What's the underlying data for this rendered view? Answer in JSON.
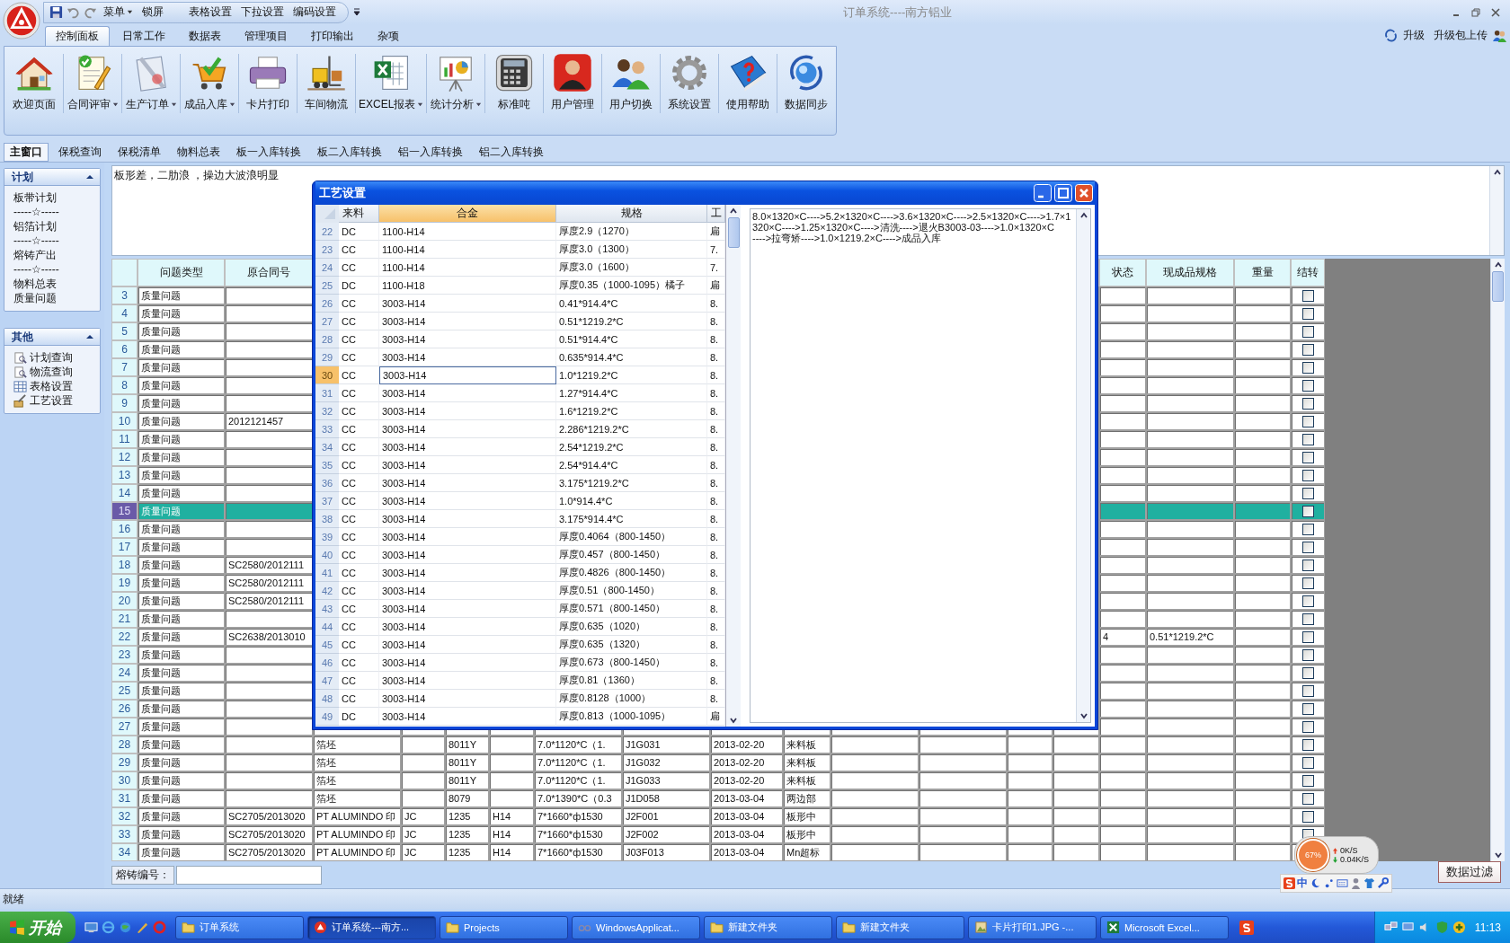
{
  "window": {
    "title": "订单系统----南方铝业"
  },
  "quick_access": {
    "menu": "菜单",
    "lock": "锁屏",
    "items": [
      "表格设置",
      "下拉设置",
      "编码设置"
    ]
  },
  "ribbon_tabs": [
    {
      "label": "控制面板",
      "selected": true
    },
    {
      "label": "日常工作",
      "selected": false
    },
    {
      "label": "数据表",
      "selected": false
    },
    {
      "label": "管理项目",
      "selected": false
    },
    {
      "label": "打印输出",
      "selected": false
    },
    {
      "label": "杂项",
      "selected": false
    }
  ],
  "ribbon_links": [
    "升级",
    "升级包上传"
  ],
  "ribbon_buttons": [
    {
      "label": "欢迎页面",
      "has_menu": false
    },
    {
      "label": "合同评审",
      "has_menu": true
    },
    {
      "label": "生产订单",
      "has_menu": true
    },
    {
      "label": "成品入库",
      "has_menu": true
    },
    {
      "label": "卡片打印",
      "has_menu": false
    },
    {
      "label": "车间物流",
      "has_menu": false
    },
    {
      "label": "EXCEL报表",
      "has_menu": true
    },
    {
      "label": "统计分析",
      "has_menu": true
    },
    {
      "label": "标准吨",
      "has_menu": false
    },
    {
      "label": "用户管理",
      "has_menu": false
    },
    {
      "label": "用户切换",
      "has_menu": false
    },
    {
      "label": "系统设置",
      "has_menu": false
    },
    {
      "label": "使用帮助",
      "has_menu": false
    },
    {
      "label": "数据同步",
      "has_menu": false
    }
  ],
  "doc_tabs": [
    {
      "label": "主窗口",
      "selected": true
    },
    {
      "label": "保税查询",
      "selected": false
    },
    {
      "label": "保税清单",
      "selected": false
    },
    {
      "label": "物料总表",
      "selected": false
    },
    {
      "label": "板一入库转换",
      "selected": false
    },
    {
      "label": "板二入库转换",
      "selected": false
    },
    {
      "label": "铝一入库转换",
      "selected": false
    },
    {
      "label": "铝二入库转换",
      "selected": false
    }
  ],
  "sidebar": {
    "panels": [
      {
        "title": "计划",
        "expanded": true,
        "items": [
          {
            "label": "板带计划",
            "kind": "link"
          },
          {
            "label": "-----☆-----",
            "kind": "separator"
          },
          {
            "label": "铝箔计划",
            "kind": "link"
          },
          {
            "label": "-----☆-----",
            "kind": "separator"
          },
          {
            "label": "熔铸产出",
            "kind": "link"
          },
          {
            "label": "-----☆-----",
            "kind": "separator"
          },
          {
            "label": "物料总表",
            "kind": "link"
          },
          {
            "label": "质量问题",
            "kind": "link"
          }
        ]
      },
      {
        "title": "其他",
        "expanded": true,
        "items": [
          {
            "label": "计划查询",
            "kind": "icon_link"
          },
          {
            "label": "物流查询",
            "kind": "icon_link"
          },
          {
            "label": "表格设置",
            "kind": "icon_link"
          },
          {
            "label": "工艺设置",
            "kind": "icon_link"
          }
        ]
      }
    ]
  },
  "memo": {
    "value": "板形差，二肋浪 ，操边大波浪明显"
  },
  "table": {
    "headers": {
      "problem_type": "问题类型",
      "original_contract_no": "原合同号",
      "status": "状态",
      "finished_spec": "现成品规格",
      "weight": "重量",
      "carry_over": "结转"
    },
    "rows": [
      {
        "number": "3",
        "selected": false,
        "problem_type": "质量问题",
        "carry_over": false
      },
      {
        "number": "4",
        "selected": false,
        "problem_type": "质量问题",
        "carry_over": false
      },
      {
        "number": "5",
        "selected": false,
        "problem_type": "质量问题",
        "carry_over": false
      },
      {
        "number": "6",
        "selected": false,
        "problem_type": "质量问题",
        "carry_over": false
      },
      {
        "number": "7",
        "selected": false,
        "problem_type": "质量问题",
        "carry_over": false
      },
      {
        "number": "8",
        "selected": false,
        "problem_type": "质量问题",
        "carry_over": false
      },
      {
        "number": "9",
        "selected": false,
        "problem_type": "质量问题",
        "carry_over": false
      },
      {
        "number": "10",
        "selected": false,
        "problem_type": "质量问题",
        "original_contract_no": "2012121457",
        "carry_over": false
      },
      {
        "number": "11",
        "selected": false,
        "problem_type": "质量问题",
        "carry_over": false
      },
      {
        "number": "12",
        "selected": false,
        "problem_type": "质量问题",
        "carry_over": false
      },
      {
        "number": "13",
        "selected": false,
        "problem_type": "质量问题",
        "carry_over": false
      },
      {
        "number": "14",
        "selected": false,
        "problem_type": "质量问题",
        "carry_over": false
      },
      {
        "number": "15",
        "selected": true,
        "problem_type": "质量问题",
        "carry_over": false
      },
      {
        "number": "16",
        "selected": false,
        "problem_type": "质量问题",
        "carry_over": false
      },
      {
        "number": "17",
        "selected": false,
        "problem_type": "质量问题",
        "carry_over": false
      },
      {
        "number": "18",
        "selected": false,
        "problem_type": "质量问题",
        "original_contract_no": "SC2580/2012111",
        "carry_over": false
      },
      {
        "number": "19",
        "selected": false,
        "problem_type": "质量问题",
        "original_contract_no": "SC2580/2012111",
        "carry_over": false
      },
      {
        "number": "20",
        "selected": false,
        "problem_type": "质量问题",
        "original_contract_no": "SC2580/2012111",
        "carry_over": false
      },
      {
        "number": "21",
        "selected": false,
        "problem_type": "质量问题",
        "carry_over": false
      },
      {
        "number": "22",
        "selected": false,
        "problem_type": "质量问题",
        "original_contract_no": "SC2638/2013010",
        "status": "4",
        "finished_spec": "0.51*1219.2*C",
        "carry_over": false
      },
      {
        "number": "23",
        "selected": false,
        "problem_type": "质量问题",
        "carry_over": false
      },
      {
        "number": "24",
        "selected": false,
        "problem_type": "质量问题",
        "carry_over": false
      },
      {
        "number": "25",
        "selected": false,
        "problem_type": "质量问题",
        "carry_over": false
      },
      {
        "number": "26",
        "selected": false,
        "problem_type": "质量问题",
        "carry_over": false
      },
      {
        "number": "27",
        "selected": false,
        "problem_type": "质量问题",
        "carry_over": false
      },
      {
        "number": "28",
        "selected": false,
        "problem_type": "质量问题",
        "column_3": "箔坯",
        "column_5": "8011Y",
        "column_7": "7.0*1120*C（1.",
        "column_8": "J1G031",
        "column_9": "2013-02-20",
        "column_10": "来料板",
        "carry_over": false
      },
      {
        "number": "29",
        "selected": false,
        "problem_type": "质量问题",
        "column_3": "箔坯",
        "column_5": "8011Y",
        "column_7": "7.0*1120*C（1.",
        "column_8": "J1G032",
        "column_9": "2013-02-20",
        "column_10": "来料板",
        "carry_over": false
      },
      {
        "number": "30",
        "selected": false,
        "problem_type": "质量问题",
        "column_3": "箔坯",
        "column_5": "8011Y",
        "column_7": "7.0*1120*C（1.",
        "column_8": "J1G033",
        "column_9": "2013-02-20",
        "column_10": "来料板",
        "carry_over": false
      },
      {
        "number": "31",
        "selected": false,
        "problem_type": "质量问题",
        "column_3": "箔坯",
        "column_5": "8079",
        "column_7": "7.0*1390*C（0.3",
        "column_8": "J1D058",
        "column_9": "2013-03-04",
        "column_10": "两边部",
        "carry_over": false
      },
      {
        "number": "32",
        "selected": false,
        "problem_type": "质量问题",
        "original_contract_no": "SC2705/2013020",
        "column_3": "PT ALUMINDO 印",
        "column_4": "JC",
        "column_5": "1235",
        "column_6": "H14",
        "column_7": "7*1660*ф1530",
        "column_8": "J2F001",
        "column_9": "2013-03-04",
        "column_10": "板形中",
        "carry_over": false
      },
      {
        "number": "33",
        "selected": false,
        "problem_type": "质量问题",
        "original_contract_no": "SC2705/2013020",
        "column_3": "PT ALUMINDO 印",
        "column_4": "JC",
        "column_5": "1235",
        "column_6": "H14",
        "column_7": "7*1660*ф1530",
        "column_8": "J2F002",
        "column_9": "2013-03-04",
        "column_10": "板形中",
        "carry_over": false
      },
      {
        "number": "34",
        "selected": false,
        "problem_type": "质量问题",
        "original_contract_no": "SC2705/2013020",
        "column_3": "PT ALUMINDO 印",
        "column_4": "JC",
        "column_5": "1235",
        "column_6": "H14",
        "column_7": "7*1660*ф1530",
        "column_8": "J03F013",
        "column_9": "2013-03-04",
        "column_10": "Mn超标"
      }
    ]
  },
  "casting_no": {
    "label": "熔铸编号："
  },
  "network_meter": {
    "load": "67%",
    "upload": "0K/S",
    "download": "0.04K/S"
  },
  "ime_bar": {
    "mode": "中"
  },
  "filter_button": "数据过滤",
  "status_bar": "就绪",
  "dialog": {
    "title": "工艺设置",
    "columns": [
      {
        "label": "来料",
        "selected": false
      },
      {
        "label": "合金",
        "selected": true
      },
      {
        "label": "规格",
        "selected": false
      },
      {
        "label": "工",
        "selected": false
      }
    ],
    "rows": [
      {
        "number": "22",
        "selected": false,
        "source": "DC",
        "alloy": "1100-H14",
        "spec": "厚度2.9（1270）",
        "process": "扁"
      },
      {
        "number": "23",
        "selected": false,
        "source": "CC",
        "alloy": "1100-H14",
        "spec": "厚度3.0（1300）",
        "process": "7."
      },
      {
        "number": "24",
        "selected": false,
        "source": "CC",
        "alloy": "1100-H14",
        "spec": "厚度3.0（1600）",
        "process": "7."
      },
      {
        "number": "25",
        "selected": false,
        "source": "DC",
        "alloy": "1100-H18",
        "spec": "厚度0.35（1000-1095）橘子",
        "process": "扁"
      },
      {
        "number": "26",
        "selected": false,
        "source": "CC",
        "alloy": "3003-H14",
        "spec": "0.41*914.4*C",
        "process": "8."
      },
      {
        "number": "27",
        "selected": false,
        "source": "CC",
        "alloy": "3003-H14",
        "spec": "0.51*1219.2*C",
        "process": "8."
      },
      {
        "number": "28",
        "selected": false,
        "source": "CC",
        "alloy": "3003-H14",
        "spec": "0.51*914.4*C",
        "process": "8."
      },
      {
        "number": "29",
        "selected": false,
        "source": "CC",
        "alloy": "3003-H14",
        "spec": "0.635*914.4*C",
        "process": "8."
      },
      {
        "number": "30",
        "selected": true,
        "source": "CC",
        "alloy": "3003-H14",
        "spec": "1.0*1219.2*C",
        "process": "8."
      },
      {
        "number": "31",
        "selected": false,
        "source": "CC",
        "alloy": "3003-H14",
        "spec": "1.27*914.4*C",
        "process": "8."
      },
      {
        "number": "32",
        "selected": false,
        "source": "CC",
        "alloy": "3003-H14",
        "spec": "1.6*1219.2*C",
        "process": "8."
      },
      {
        "number": "33",
        "selected": false,
        "source": "CC",
        "alloy": "3003-H14",
        "spec": "2.286*1219.2*C",
        "process": "8."
      },
      {
        "number": "34",
        "selected": false,
        "source": "CC",
        "alloy": "3003-H14",
        "spec": "2.54*1219.2*C",
        "process": "8."
      },
      {
        "number": "35",
        "selected": false,
        "source": "CC",
        "alloy": "3003-H14",
        "spec": "2.54*914.4*C",
        "process": "8."
      },
      {
        "number": "36",
        "selected": false,
        "source": "CC",
        "alloy": "3003-H14",
        "spec": "3.175*1219.2*C",
        "process": "8."
      },
      {
        "number": "37",
        "selected": false,
        "source": "CC",
        "alloy": "3003-H14",
        "spec": "1.0*914.4*C",
        "process": "8."
      },
      {
        "number": "38",
        "selected": false,
        "source": "CC",
        "alloy": "3003-H14",
        "spec": "3.175*914.4*C",
        "process": "8."
      },
      {
        "number": "39",
        "selected": false,
        "source": "CC",
        "alloy": "3003-H14",
        "spec": "厚度0.4064（800-1450）",
        "process": "8."
      },
      {
        "number": "40",
        "selected": false,
        "source": "CC",
        "alloy": "3003-H14",
        "spec": "厚度0.457（800-1450）",
        "process": "8."
      },
      {
        "number": "41",
        "selected": false,
        "source": "CC",
        "alloy": "3003-H14",
        "spec": "厚度0.4826（800-1450）",
        "process": "8."
      },
      {
        "number": "42",
        "selected": false,
        "source": "CC",
        "alloy": "3003-H14",
        "spec": "厚度0.51（800-1450）",
        "process": "8."
      },
      {
        "number": "43",
        "selected": false,
        "source": "CC",
        "alloy": "3003-H14",
        "spec": "厚度0.571（800-1450）",
        "process": "8."
      },
      {
        "number": "44",
        "selected": false,
        "source": "CC",
        "alloy": "3003-H14",
        "spec": "厚度0.635（1020）",
        "process": "8."
      },
      {
        "number": "45",
        "selected": false,
        "source": "CC",
        "alloy": "3003-H14",
        "spec": "厚度0.635（1320）",
        "process": "8."
      },
      {
        "number": "46",
        "selected": false,
        "source": "CC",
        "alloy": "3003-H14",
        "spec": "厚度0.673（800-1450）",
        "process": "8."
      },
      {
        "number": "47",
        "selected": false,
        "source": "CC",
        "alloy": "3003-H14",
        "spec": "厚度0.81（1360）",
        "process": "8."
      },
      {
        "number": "48",
        "selected": false,
        "source": "CC",
        "alloy": "3003-H14",
        "spec": "厚度0.8128（1000）",
        "process": "8."
      },
      {
        "number": "49",
        "selected": false,
        "source": "DC",
        "alloy": "3003-H14",
        "spec": "厚度0.813（1000-1095）",
        "process": "扁"
      }
    ],
    "process_text": "8.0×1320×C---->5.2×1320×C---->3.6×1320×C---->2.5×1320×C---->1.7×1320×C---->1.25×1320×C---->清洗---->退火B3003-03---->1.0×1320×C\n---->拉弯矫---->1.0×1219.2×C---->成品入库"
  },
  "taskbar": {
    "start": "开始",
    "tasks": [
      {
        "label": "订单系统",
        "selected": false
      },
      {
        "label": "订单系统---南方...",
        "selected": true
      },
      {
        "label": "Projects",
        "selected": false
      },
      {
        "label": "WindowsApplicat...",
        "selected": false
      },
      {
        "label": "新建文件夹",
        "selected": false
      },
      {
        "label": "新建文件夹",
        "selected": false
      },
      {
        "label": "卡片打印1.JPG -...",
        "selected": false
      },
      {
        "label": "Microsoft Excel...",
        "selected": false
      }
    ],
    "clock": "11:13"
  }
}
